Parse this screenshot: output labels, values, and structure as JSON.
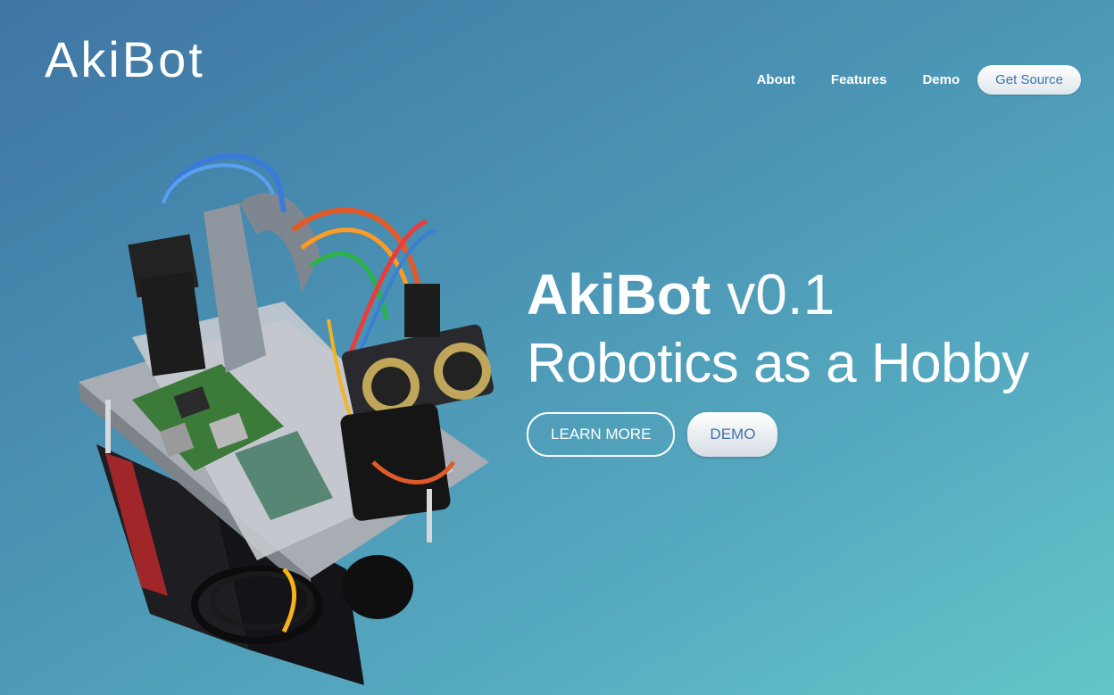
{
  "brand": {
    "logo_text": "AkiBot"
  },
  "nav": {
    "items": [
      {
        "label": "About"
      },
      {
        "label": "Features"
      },
      {
        "label": "Demo"
      }
    ],
    "cta_label": "Get Source"
  },
  "hero": {
    "title_name": "AkiBot",
    "title_version": "v0.1",
    "subtitle": "Robotics as a Hobby",
    "learn_more_label": "LEARN MORE",
    "demo_label": "DEMO"
  },
  "robot_image": {
    "icon": "robot-photo"
  },
  "colors": {
    "gradient_start": "#3f75a3",
    "gradient_end": "#63c6c9",
    "button_text": "#3f73a8"
  }
}
